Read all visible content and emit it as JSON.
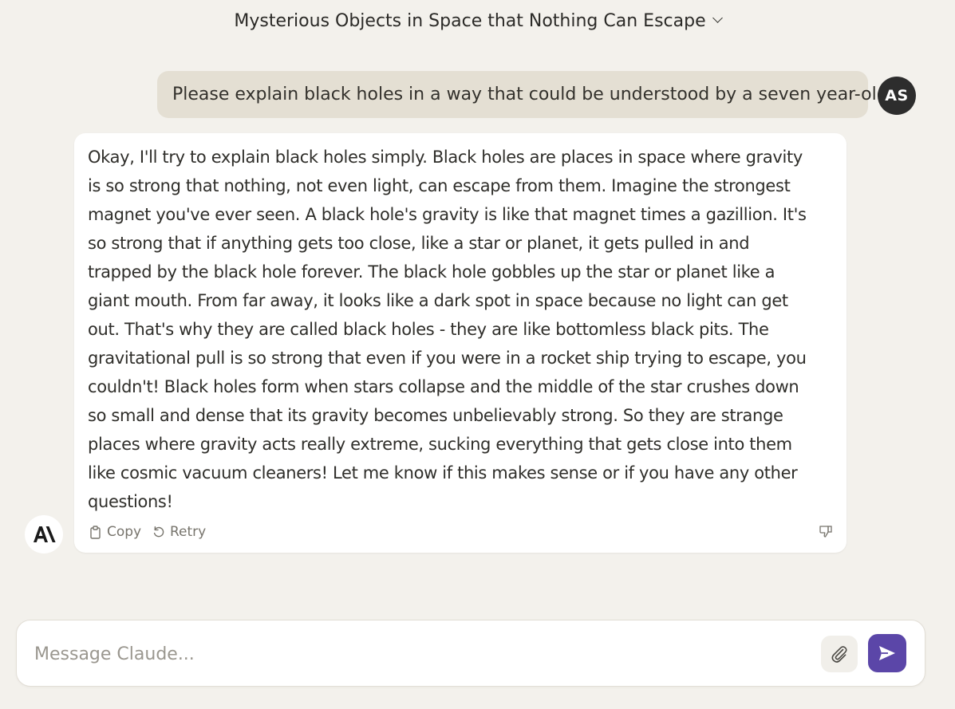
{
  "header": {
    "title": "Mysterious Objects in Space that Nothing Can Escape"
  },
  "user_message": {
    "text": "Please explain black holes in a way that could be understood by a seven year-old",
    "avatar_initials": "AS"
  },
  "assistant_message": {
    "lines": [
      "Okay, I'll try to explain black holes simply. Black holes are places in space where gravity",
      "is so strong that nothing, not even light, can escape from them. Imagine the strongest",
      "magnet you've ever seen. A black hole's gravity is like that magnet times a gazillion. It's",
      "so strong that if anything gets too close, like a star or planet, it gets pulled in and",
      "trapped by the black hole forever.  The black hole gobbles up the star or planet like a",
      "giant mouth. From far away, it looks like a dark spot in space because no light can get",
      "out. That's why they are called black holes - they are like bottomless black pits. The",
      "gravitational pull is so strong that even if you were in a rocket ship trying to escape, you",
      "couldn't! Black holes form when stars collapse and the middle of the star crushes down",
      "so small and dense that its gravity becomes unbelievably strong. So they are strange",
      "places where gravity acts really extreme, sucking everything that gets close into them",
      "like cosmic vacuum cleaners! Let me know if this makes sense or if you have any other",
      "questions!"
    ],
    "actions": {
      "copy_label": "Copy",
      "retry_label": "Retry"
    }
  },
  "composer": {
    "placeholder": "Message Claude...",
    "value": ""
  },
  "colors": {
    "background": "#f3f1ec",
    "user_bubble": "#e4dfd3",
    "send_button": "#5b46a8",
    "avatar": "#2d2d2d"
  },
  "icons": {
    "title_dropdown": "chevron-down-icon",
    "copy": "clipboard-icon",
    "retry": "retry-icon",
    "feedback": "thumbs-down-icon",
    "assistant_logo": "anthropic-logo-icon",
    "attach": "paperclip-icon",
    "send": "send-arrow-icon"
  }
}
